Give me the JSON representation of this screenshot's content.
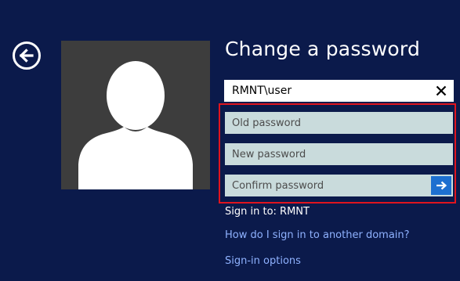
{
  "page": {
    "title": "Change a password"
  },
  "back_button": {
    "icon": "arrow-left-icon"
  },
  "user_tile": {
    "icon": "user-silhouette-icon"
  },
  "username_field": {
    "value": "RMNT\\user",
    "clear_icon": "close-icon"
  },
  "password_fields": {
    "old_placeholder": "Old password",
    "new_placeholder": "New password",
    "confirm_placeholder": "Confirm password",
    "submit_icon": "arrow-right-icon"
  },
  "signin": {
    "domain_text": "Sign in to: RMNT",
    "other_domain_link": "How do I sign in to another domain?",
    "options_link": "Sign-in options"
  },
  "colors": {
    "background": "#0b1a4b",
    "highlight_border": "#e0141e",
    "password_field_bg": "#c9dbdc",
    "submit_button": "#1d6fd0",
    "link": "#8fb2ff"
  }
}
